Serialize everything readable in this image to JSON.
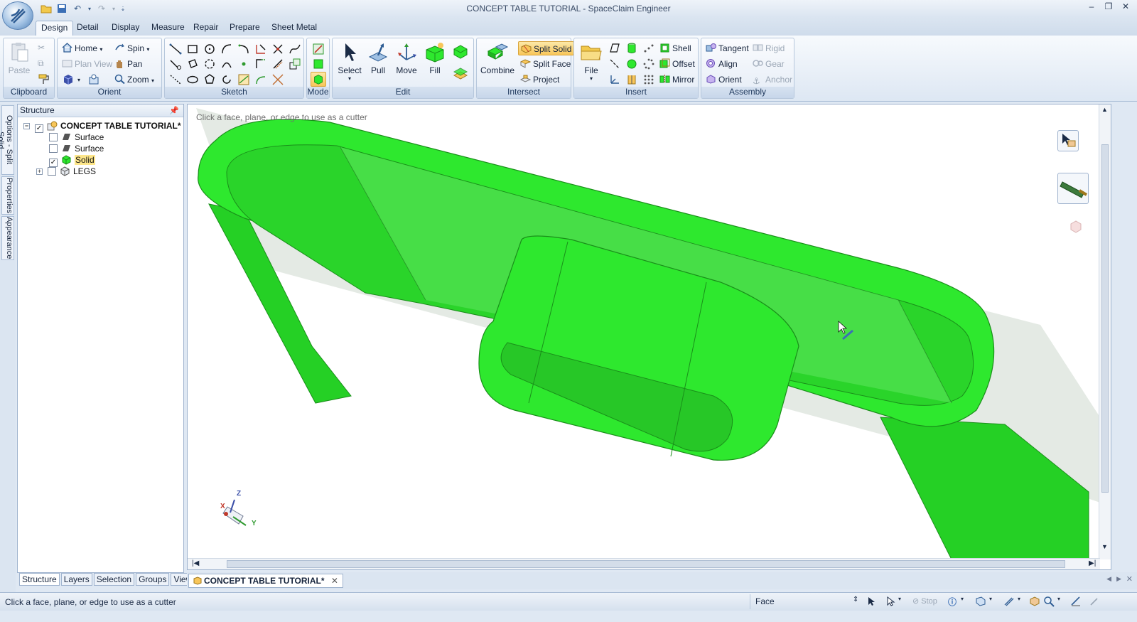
{
  "window": {
    "title": "CONCEPT TABLE TUTORIAL - SpaceClaim Engineer"
  },
  "ribbon_tabs": [
    "Design",
    "Detail",
    "Display",
    "Measure",
    "Repair",
    "Prepare",
    "Sheet Metal"
  ],
  "groups": {
    "clipboard": {
      "label": "Clipboard",
      "paste": "Paste"
    },
    "orient": {
      "label": "Orient",
      "home": "Home",
      "spin": "Spin",
      "plan_view": "Plan View",
      "pan": "Pan",
      "zoom": "Zoom"
    },
    "sketch": {
      "label": "Sketch"
    },
    "mode": {
      "label": "Mode"
    },
    "edit": {
      "label": "Edit",
      "select": "Select",
      "pull": "Pull",
      "move": "Move",
      "fill": "Fill"
    },
    "intersect": {
      "label": "Intersect",
      "combine": "Combine",
      "split_solid": "Split Solid",
      "split_face": "Split Face",
      "project": "Project"
    },
    "insert": {
      "label": "Insert",
      "file": "File",
      "shell": "Shell",
      "offset": "Offset",
      "mirror": "Mirror"
    },
    "assembly": {
      "label": "Assembly",
      "tangent": "Tangent",
      "align": "Align",
      "orient": "Orient",
      "rigid": "Rigid",
      "gear": "Gear",
      "anchor": "Anchor"
    }
  },
  "side_tabs": [
    "Options - Split Solid",
    "Properties",
    "Appearance"
  ],
  "structure": {
    "title": "Structure",
    "root": "CONCEPT TABLE TUTORIAL*",
    "nodes": [
      {
        "label": "Surface",
        "checked": false
      },
      {
        "label": "Surface",
        "checked": false
      },
      {
        "label": "Solid",
        "checked": true
      },
      {
        "label": "LEGS",
        "checked": false
      }
    ]
  },
  "panel_tabs": [
    "Structure",
    "Layers",
    "Selection",
    "Groups",
    "Views"
  ],
  "viewport": {
    "hint": "Click a face, plane, or edge to use as a cutter",
    "triad": {
      "x": "X",
      "y": "Y",
      "z": "Z"
    }
  },
  "document_tab": "CONCEPT TABLE TUTORIAL*",
  "status": {
    "message": "Click a face, plane, or edge to use as a cutter",
    "selection_filter": "Face",
    "stop": "Stop"
  },
  "colors": {
    "solid_green": "#2ee82e",
    "solid_edge": "#1a8f1a",
    "highlight": "#fde68a",
    "accent_blue": "#3b6fb6"
  }
}
